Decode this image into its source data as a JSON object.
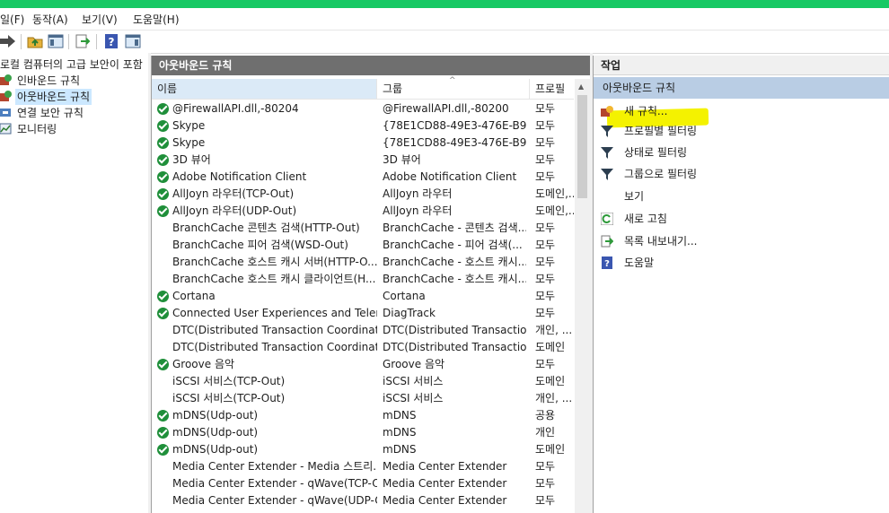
{
  "menu": [
    "일(F)",
    "동작(A)",
    "보기(V)",
    "도움말(H)"
  ],
  "tree": {
    "root": "로컬 컴퓨터의 고급 보안이 포함",
    "items": [
      "인바운드 규칙",
      "아웃바운드 규칙",
      "연결 보안 규칙",
      "모니터링"
    ]
  },
  "center": {
    "title": "아웃바운드 규칙",
    "columns": [
      "이름",
      "그룹",
      "프로필"
    ],
    "rows": [
      {
        "enabled": true,
        "name": "@FirewallAPI.dll,-80204",
        "group": "@FirewallAPI.dll,-80200",
        "profile": "모두"
      },
      {
        "enabled": true,
        "name": "Skype",
        "group": "{78E1CD88-49E3-476E-B9...",
        "profile": "모두"
      },
      {
        "enabled": true,
        "name": "Skype",
        "group": "{78E1CD88-49E3-476E-B9...",
        "profile": "모두"
      },
      {
        "enabled": true,
        "name": "3D 뷰어",
        "group": "3D 뷰어",
        "profile": "모두"
      },
      {
        "enabled": true,
        "name": "Adobe Notification Client",
        "group": "Adobe Notification Client",
        "profile": "모두"
      },
      {
        "enabled": true,
        "name": "AllJoyn 라우터(TCP-Out)",
        "group": "AllJoyn 라우터",
        "profile": "도메인,..."
      },
      {
        "enabled": true,
        "name": "AllJoyn 라우터(UDP-Out)",
        "group": "AllJoyn 라우터",
        "profile": "도메인,..."
      },
      {
        "enabled": false,
        "name": "BranchCache 콘텐츠 검색(HTTP-Out)",
        "group": "BranchCache - 콘텐츠 검색...",
        "profile": "모두"
      },
      {
        "enabled": false,
        "name": "BranchCache 피어 검색(WSD-Out)",
        "group": "BranchCache - 피어 검색(...",
        "profile": "모두"
      },
      {
        "enabled": false,
        "name": "BranchCache 호스트 캐시 서버(HTTP-O...",
        "group": "BranchCache - 호스트 캐시...",
        "profile": "모두"
      },
      {
        "enabled": false,
        "name": "BranchCache 호스트 캐시 클라이언트(H...",
        "group": "BranchCache - 호스트 캐시...",
        "profile": "모두"
      },
      {
        "enabled": true,
        "name": "Cortana",
        "group": "Cortana",
        "profile": "모두"
      },
      {
        "enabled": true,
        "name": "Connected User Experiences and Teleme...",
        "group": "DiagTrack",
        "profile": "모두"
      },
      {
        "enabled": false,
        "name": "DTC(Distributed Transaction Coordinato...",
        "group": "DTC(Distributed Transactio...",
        "profile": "개인, ..."
      },
      {
        "enabled": false,
        "name": "DTC(Distributed Transaction Coordinato...",
        "group": "DTC(Distributed Transactio...",
        "profile": "도메인"
      },
      {
        "enabled": true,
        "name": "Groove 음악",
        "group": "Groove 음악",
        "profile": "모두"
      },
      {
        "enabled": false,
        "name": "iSCSI 서비스(TCP-Out)",
        "group": "iSCSI 서비스",
        "profile": "도메인"
      },
      {
        "enabled": false,
        "name": "iSCSI 서비스(TCP-Out)",
        "group": "iSCSI 서비스",
        "profile": "개인, ..."
      },
      {
        "enabled": true,
        "name": "mDNS(Udp-out)",
        "group": "mDNS",
        "profile": "공용"
      },
      {
        "enabled": true,
        "name": "mDNS(Udp-out)",
        "group": "mDNS",
        "profile": "개인"
      },
      {
        "enabled": true,
        "name": "mDNS(Udp-out)",
        "group": "mDNS",
        "profile": "도메인"
      },
      {
        "enabled": false,
        "name": "Media Center Extender - Media 스트리...",
        "group": "Media Center Extender",
        "profile": "모두"
      },
      {
        "enabled": false,
        "name": "Media Center Extender - qWave(TCP-Out)",
        "group": "Media Center Extender",
        "profile": "모두"
      },
      {
        "enabled": false,
        "name": "Media Center Extender - qWave(UDP-O...",
        "group": "Media Center Extender",
        "profile": "모두"
      }
    ]
  },
  "actions": {
    "title": "작업",
    "section": "아웃바운드 규칙",
    "items": [
      {
        "label": "새 규칙...",
        "icon": "new-rule-icon"
      },
      {
        "label": "프로필별 필터링",
        "icon": "filter-icon"
      },
      {
        "label": "상태로 필터링",
        "icon": "filter-icon"
      },
      {
        "label": "그룹으로 필터링",
        "icon": "filter-icon"
      },
      {
        "label": "보기",
        "icon": ""
      },
      {
        "label": "새로 고침",
        "icon": "refresh-icon"
      },
      {
        "label": "목록 내보내기...",
        "icon": "export-icon"
      },
      {
        "label": "도움말",
        "icon": "help-icon"
      }
    ]
  },
  "colors": {
    "title_bar": "#17c964",
    "pane_title": "#6f6f6f",
    "section": "#b9cde4",
    "highlight": "#f4f200",
    "check": "#1f8f3a"
  }
}
